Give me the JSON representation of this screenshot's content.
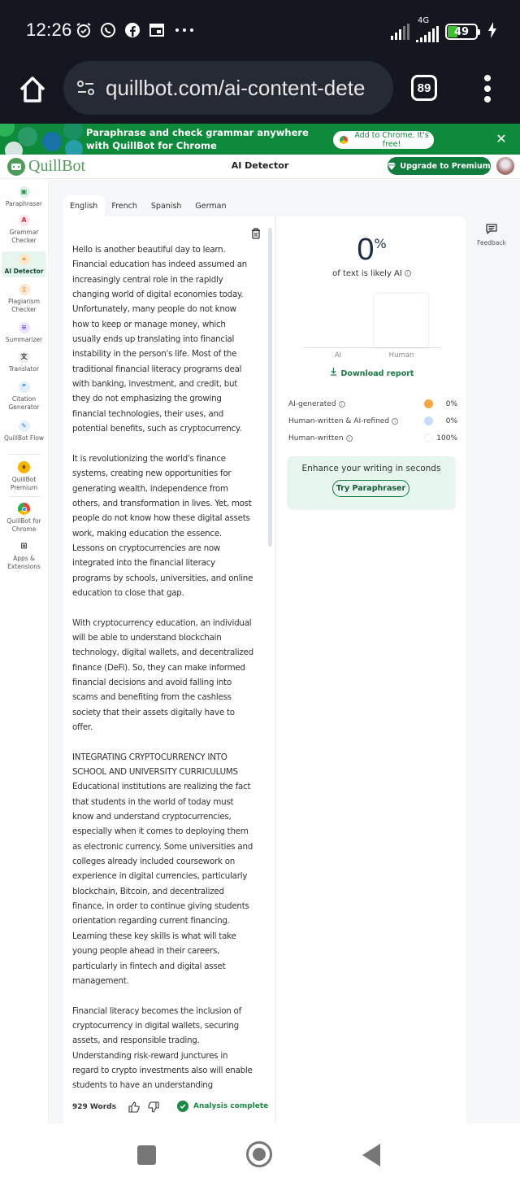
{
  "status_bar": {
    "time": "12:26",
    "notification_icons": [
      "alarm-icon",
      "whatsapp-icon",
      "facebook-icon",
      "calendar-icon",
      "more-icon"
    ],
    "network_label": "4G",
    "battery_level": "49"
  },
  "browser": {
    "url": "quillbot.com/ai-content-dete",
    "tab_count": "89"
  },
  "promo_banner": {
    "text": "Paraphrase and check grammar anywhere with QuillBot for Chrome",
    "cta_label": "Add to Chrome. It's free!",
    "close_label": "✕"
  },
  "header": {
    "logo_text": "QuillBot",
    "title": "AI Detector",
    "upgrade_label": "Upgrade to Premium"
  },
  "sidebar": {
    "items": [
      {
        "label": "Paraphraser",
        "icon": "paraphraser-icon"
      },
      {
        "label": "Grammar Checker",
        "icon": "grammar-checker-icon"
      },
      {
        "label": "AI Detector",
        "icon": "ai-detector-icon",
        "active": true
      },
      {
        "label": "Plagiarism Checker",
        "icon": "plagiarism-checker-icon"
      },
      {
        "label": "Summarizer",
        "icon": "summarizer-icon"
      },
      {
        "label": "Translator",
        "icon": "translator-icon"
      },
      {
        "label": "Citation Generator",
        "icon": "citation-icon"
      },
      {
        "label": "QuillBot Flow",
        "icon": "flow-icon"
      },
      {
        "label": "QuillBot Premium",
        "icon": "premium-icon"
      },
      {
        "label": "QuillBot for Chrome",
        "icon": "chrome-icon"
      },
      {
        "label": "Apps & Extensions",
        "icon": "apps-icon"
      }
    ]
  },
  "language_tabs": [
    {
      "label": "English",
      "active": true
    },
    {
      "label": "French"
    },
    {
      "label": "Spanish"
    },
    {
      "label": "German"
    }
  ],
  "editor": {
    "paragraphs": [
      "Hello is another beautiful day to learn. Financial education has indeed assumed an increasingly central role in the rapidly changing world of digital economies today. Unfortunately, many people do not know how to keep or manage money, which usually ends up translating into financial instability in the person's life. Most of the traditional financial literacy programs deal with banking, investment, and credit, but they do not emphasizing the growing financial technologies, their uses, and potential benefits, such as cryptocurrency.",
      "It is revolutionizing the world's finance systems, creating new opportunities for generating wealth, independence from others, and transformation in lives. Yet, most people do not know how these digital assets work, making education the essence. Lessons on cryptocurrencies are now integrated into the financial literacy programs by schools, universities, and online education to close that gap.",
      "With cryptocurrency education, an individual will be able to understand blockchain technology, digital wallets, and decentralized finance (DeFi). So, they can make informed financial decisions and avoid falling into scams and benefiting from the cashless society that their assets digitally have to offer.",
      "INTEGRATING CRYPTOCURRENCY INTO SCHOOL AND UNIVERSITY CURRICULUMS Educational institutions are realizing the fact that students in the world of today must know and understand cryptocurrencies, especially when it comes to deploying them as electronic currency. Some universities and colleges already included coursework on experience in digital currencies, particularly blockchain, Bitcoin, and decentralized finance, in order to continue giving students orientation regarding current financing. Learning these key skills is what will take young people ahead in their careers, particularly in fintech and digital asset management.",
      "Financial literacy becomes the inclusion of cryptocurrency in digital wallets, securing assets, and responsible trading. Understanding risk-reward junctures in regard to crypto investments also will enable students to have an understanding"
    ],
    "word_count": "929 Words",
    "status": "Analysis complete"
  },
  "results": {
    "score": "0",
    "score_unit": "%",
    "caption": "of text is likely AI",
    "chart": {
      "categories": [
        "AI",
        "Human"
      ],
      "values": [
        0,
        100
      ]
    },
    "download_label": "Download report",
    "breakdown": [
      {
        "label": "AI-generated",
        "value": "0%",
        "color": "#f7a445"
      },
      {
        "label": "Human-written & AI-refined",
        "value": "0%",
        "color": "#c9dcf7"
      },
      {
        "label": "Human-written",
        "value": "100%",
        "color": "#ffffff"
      }
    ],
    "enhance_title": "Enhance your writing in seconds",
    "enhance_button": "Try Paraphraser"
  },
  "feedback_label": "Feedback",
  "colors": {
    "brand_green": "#127c3e",
    "banner_green": "#0e8a3d",
    "logo_green": "#4f9b59",
    "status_green": "#1b8a45"
  }
}
